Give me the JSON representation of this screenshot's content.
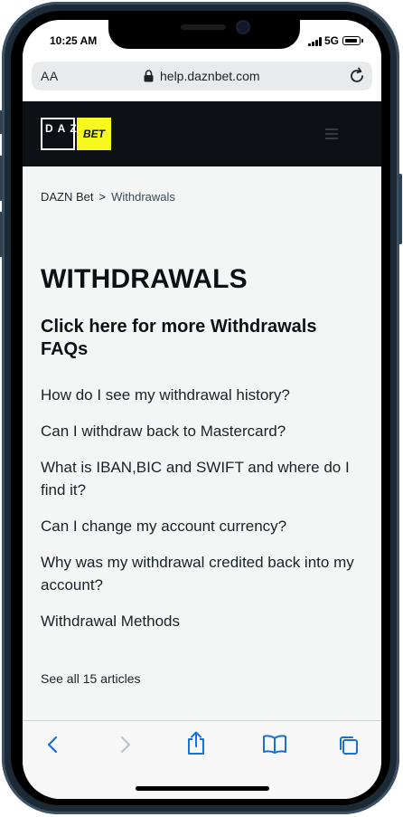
{
  "status_bar": {
    "time": "10:25 AM",
    "network": "5G"
  },
  "browser": {
    "text_size_label": "AA",
    "url": "help.daznbet.com"
  },
  "site_header": {
    "logo_dazn_text": "DAZN",
    "logo_bet_text": "BET"
  },
  "breadcrumb": {
    "root": "DAZN Bet",
    "separator": ">",
    "current": "Withdrawals"
  },
  "page": {
    "title": "WITHDRAWALS",
    "section_link": "Click here for more Withdrawals FAQs",
    "articles": [
      "How do I see my withdrawal history?",
      "Can I withdraw back to Mastercard?",
      "What is IBAN,BIC and SWIFT and where do I find it?",
      "Can I change my account currency?",
      "Why was my withdrawal credited back into my account?",
      "Withdrawal Methods"
    ],
    "see_all": "See all 15 articles"
  },
  "toolbar": {
    "icons": [
      "back-icon",
      "forward-icon",
      "share-icon",
      "bookmarks-icon",
      "tabs-icon"
    ]
  },
  "colors": {
    "header_bg": "#0d1116",
    "brand_yellow": "#f6f81e",
    "link_blue": "#1a6fd8"
  }
}
